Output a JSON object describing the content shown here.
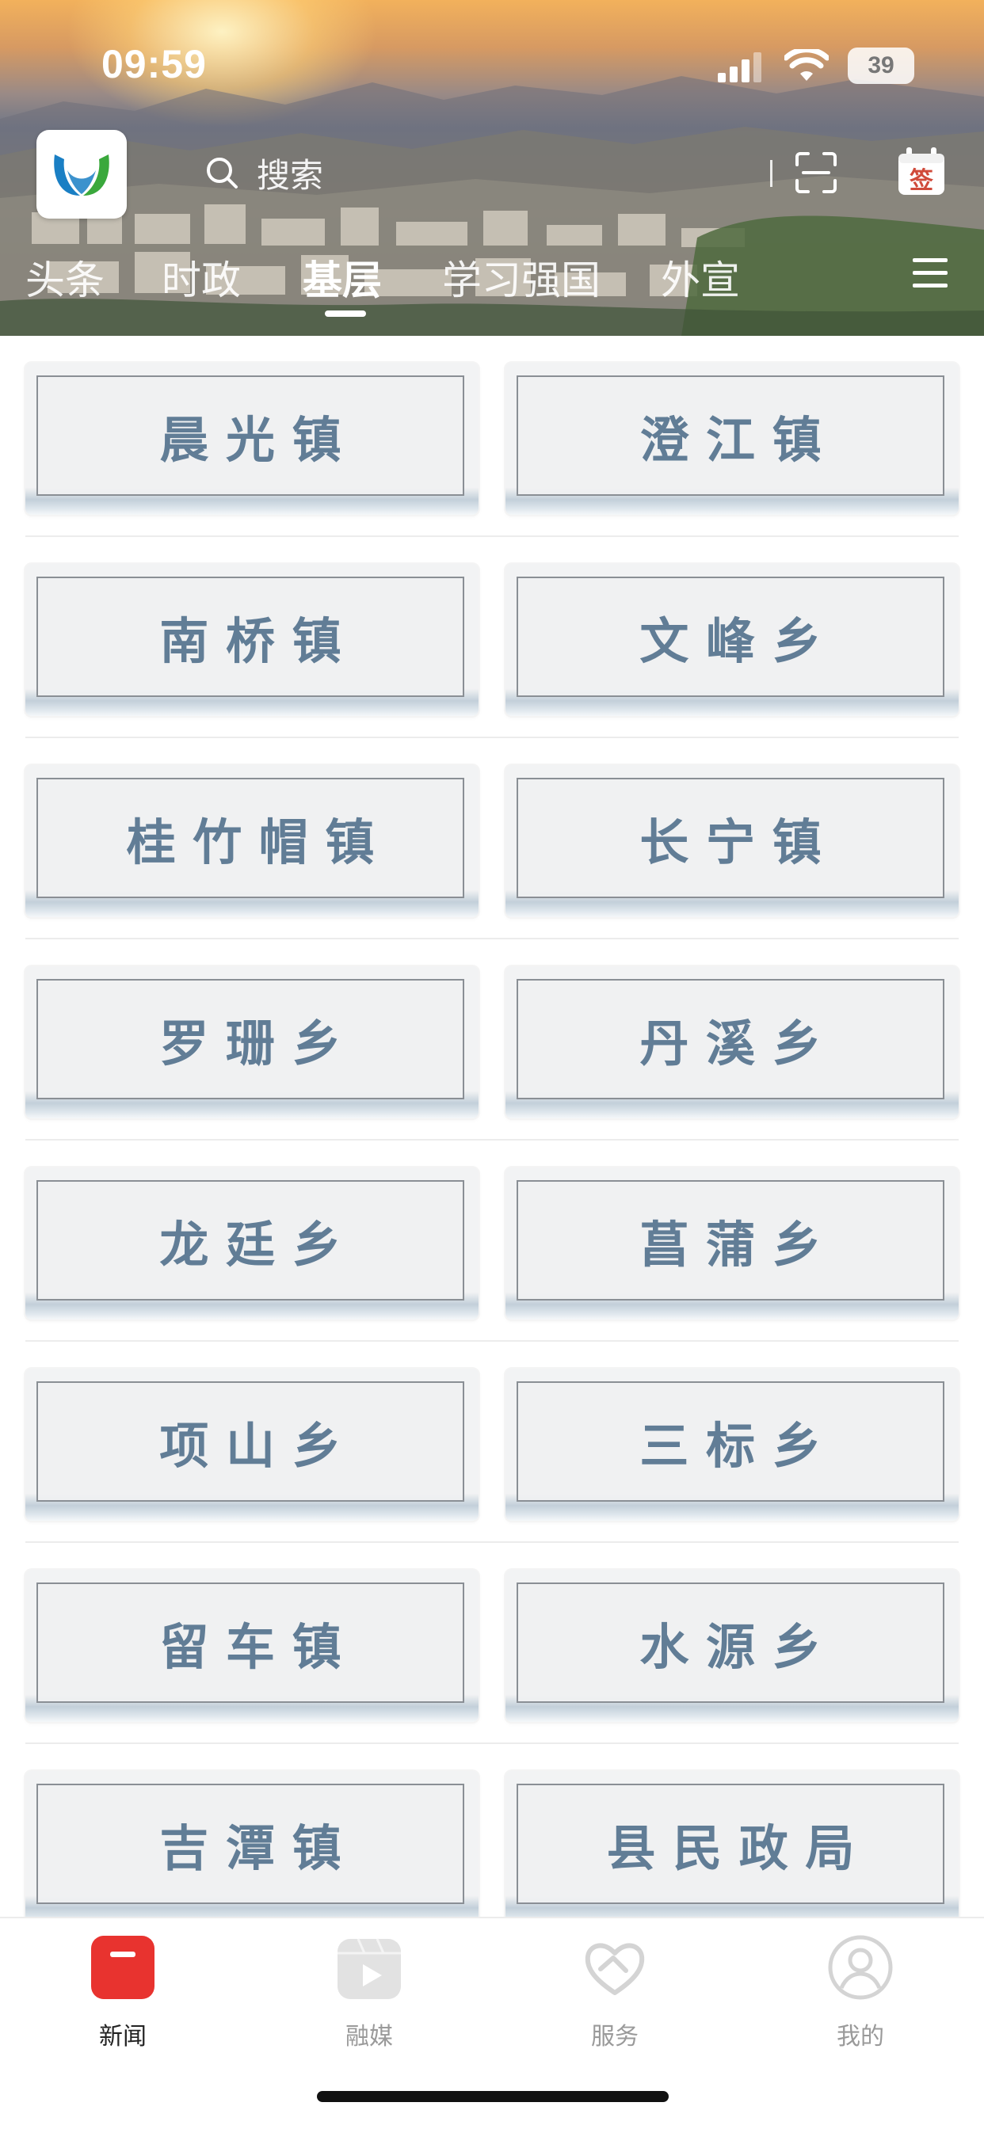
{
  "status_bar": {
    "time": "09:59",
    "battery": "39"
  },
  "header": {
    "search_placeholder": "搜索",
    "checkin_label": "签",
    "tabs": [
      {
        "label": "头条"
      },
      {
        "label": "时政"
      },
      {
        "label": "基层",
        "active": true
      },
      {
        "label": "学习强国"
      },
      {
        "label": "外宣"
      }
    ]
  },
  "grid": {
    "items": [
      "晨 光 镇",
      "澄 江 镇",
      "南 桥 镇",
      "文 峰 乡",
      "桂 竹 帽 镇",
      "长 宁 镇",
      "罗 珊 乡",
      "丹 溪 乡",
      "龙 廷 乡",
      "菖 蒲 乡",
      "项 山 乡",
      "三 标 乡",
      "留 车 镇",
      "水 源 乡",
      "吉 潭 镇",
      "县 民 政 局"
    ]
  },
  "bottom_nav": {
    "items": [
      {
        "label": "新闻",
        "icon": "news-icon",
        "active": true
      },
      {
        "label": "融媒",
        "icon": "media-play-icon"
      },
      {
        "label": "服务",
        "icon": "heart-hand-icon"
      },
      {
        "label": "我的",
        "icon": "profile-icon"
      }
    ]
  },
  "colors": {
    "accent_red": "#e8332f",
    "card_text": "#617d96",
    "tab_label_inactive": "#9a9a9a"
  }
}
